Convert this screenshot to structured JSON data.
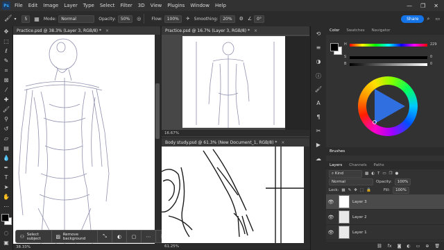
{
  "menubar": {
    "app_icon": "Ps",
    "items": [
      "File",
      "Edit",
      "Image",
      "Layer",
      "Type",
      "Select",
      "Filter",
      "3D",
      "View",
      "Plugins",
      "Window",
      "Help"
    ],
    "window_controls": [
      "—",
      "❐",
      "✕"
    ]
  },
  "options": {
    "brush_size": "5",
    "mode_label": "Mode:",
    "mode_value": "Normal",
    "opacity_label": "Opacity:",
    "opacity_value": "50%",
    "flow_label": "Flow:",
    "flow_value": "100%",
    "smoothing_label": "Smoothing:",
    "smoothing_value": "20%",
    "angle_value": "0°",
    "share_label": "Share"
  },
  "documents": {
    "doc1": {
      "tab": "Practice.psd @ 38.3% (Layer 3, RGB/8) *",
      "zoom": "38.33%"
    },
    "doc2": {
      "tab": "Practice.psd @ 16.7% (Layer 3, RGB/8) *",
      "zoom": "16.67%"
    },
    "doc3": {
      "tab": "Body study.psd @ 61.3% (New Document_1, RGB/8) *",
      "zoom": "61.25%"
    }
  },
  "context_bar": {
    "select_subject": "Select subject",
    "remove_background": "Remove background"
  },
  "color_panel": {
    "tabs": [
      "Color",
      "Swatches",
      "Navigator"
    ],
    "h_label": "H",
    "s_label": "S",
    "b_label": "B",
    "h_value": "229",
    "s_value": "0",
    "b_value": "0",
    "fg_color": "#000000",
    "bg_color": "#ffffff",
    "wheel_triangle_color": "#2f6fe0"
  },
  "brushes_panel": {
    "title": "Brushes"
  },
  "layers_panel": {
    "tabs": [
      "Layers",
      "Channels",
      "Paths"
    ],
    "kind_label": "Kind",
    "blend_mode": "Normal",
    "opacity_label": "Opacity:",
    "opacity_value": "100%",
    "lock_label": "Lock:",
    "fill_label": "Fill:",
    "fill_value": "100%",
    "layers": [
      {
        "name": "Layer 3"
      },
      {
        "name": "Layer 2"
      },
      {
        "name": "Layer 1"
      }
    ],
    "footer_fx": "fx"
  }
}
